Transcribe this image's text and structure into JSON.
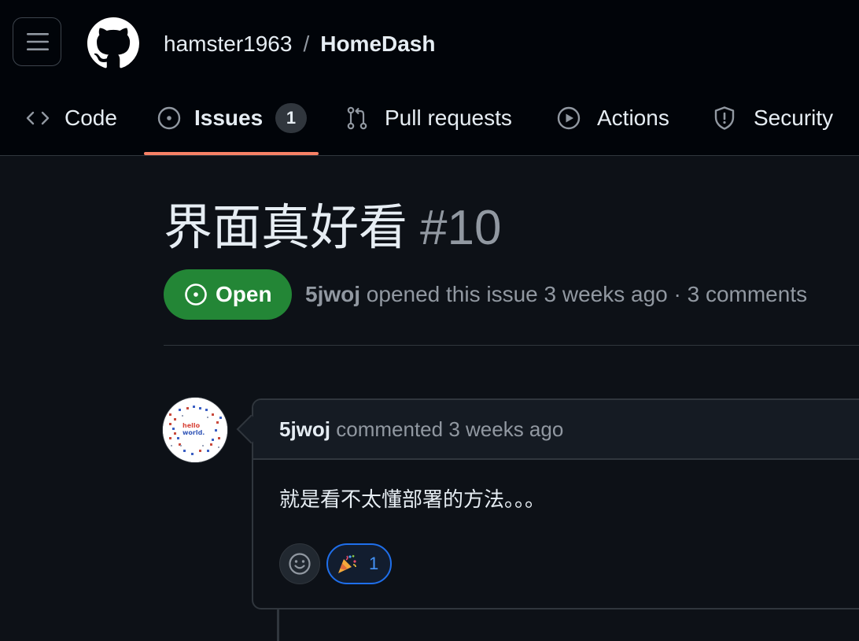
{
  "header": {
    "menu_icon": "hamburger-icon",
    "logo_icon": "github-mark-icon",
    "repo_owner": "hamster1963",
    "separator": "/",
    "repo_name": "HomeDash"
  },
  "tabs": [
    {
      "label": "Code",
      "icon": "code-icon",
      "active": false
    },
    {
      "label": "Issues",
      "icon": "issue-opened-icon",
      "active": true,
      "count": "1"
    },
    {
      "label": "Pull requests",
      "icon": "git-pull-request-icon",
      "active": false
    },
    {
      "label": "Actions",
      "icon": "play-icon",
      "active": false
    },
    {
      "label": "Security",
      "icon": "shield-icon",
      "active": false
    }
  ],
  "issue": {
    "title": "界面真好看",
    "number": "#10",
    "state": "Open",
    "author": "5jwoj",
    "meta_text": "opened this issue 3 weeks ago · 3 comments"
  },
  "comment": {
    "author": "5jwoj",
    "meta_text": "commented 3 weeks ago",
    "body": "就是看不太懂部署的方法。。。",
    "avatar_text": [
      "hello",
      "world."
    ],
    "reactions": [
      {
        "emoji": "🎉",
        "icon": "tada-icon",
        "count": "1"
      }
    ],
    "add_reaction_icon": "smiley-icon"
  },
  "colors": {
    "background": "#0d1117",
    "header_bg": "#010409",
    "open_green": "#238636",
    "active_tab_underline": "#f78166",
    "reaction_blue": "#1f6feb",
    "muted_text": "#9198a1"
  }
}
